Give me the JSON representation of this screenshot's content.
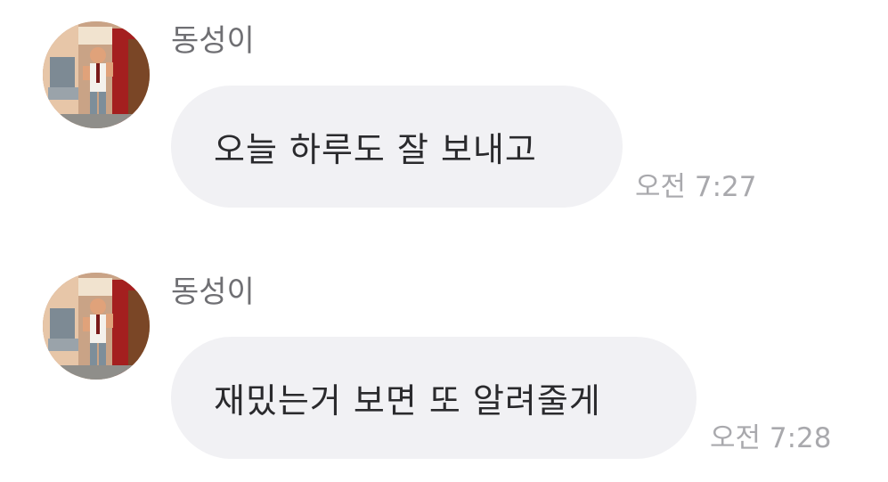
{
  "messages": [
    {
      "sender": "동성이",
      "text": "오늘 하루도 잘 보내고",
      "time": "오전 7:27",
      "avatar_icon": "profile-photo"
    },
    {
      "sender": "동성이",
      "text": "재밌는거 보면 또 알려줄게",
      "time": "오전 7:28",
      "avatar_icon": "profile-photo"
    }
  ],
  "colors": {
    "bubble": "#f1f1f4",
    "text": "#2a2a2d",
    "sender": "#6f6f73",
    "timestamp": "#a9a9ad"
  }
}
